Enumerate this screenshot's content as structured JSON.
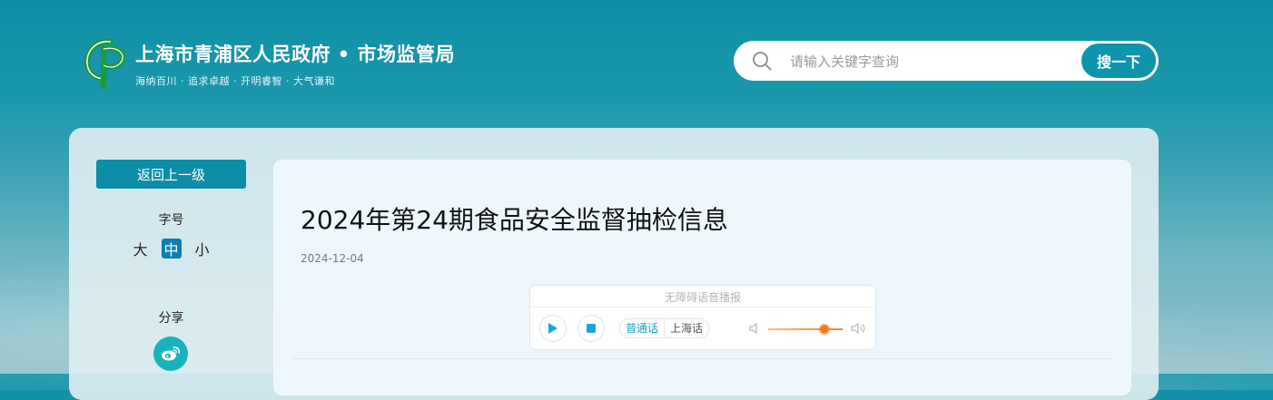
{
  "header": {
    "site_title": "上海市青浦区人民政府 • 市场监管局",
    "slogan": "海纳百川 · 追求卓越 · 开明睿智 · 大气谦和",
    "logo_icon": "qingpu-logo-icon"
  },
  "search": {
    "placeholder": "请输入关键字查询",
    "button_label": "搜一下",
    "icon": "search-icon"
  },
  "sidebar": {
    "back_label": "返回上一级",
    "font_size_label": "字号",
    "font_sizes": [
      "大",
      "中",
      "小"
    ],
    "font_size_selected": "中",
    "share_label": "分享",
    "share_icon": "weibo-icon"
  },
  "article": {
    "title": "2024年第24期食品安全监督抽检信息",
    "date": "2024-12-04"
  },
  "player": {
    "title": "无障碍语音播报",
    "lang_mandarin": "普通话",
    "lang_shanghai": "上海话",
    "volume_fraction": 0.75
  },
  "colors": {
    "accent": "#0d8ea6",
    "active_font": "#0d7fb5",
    "volume": "#f08a1c"
  }
}
